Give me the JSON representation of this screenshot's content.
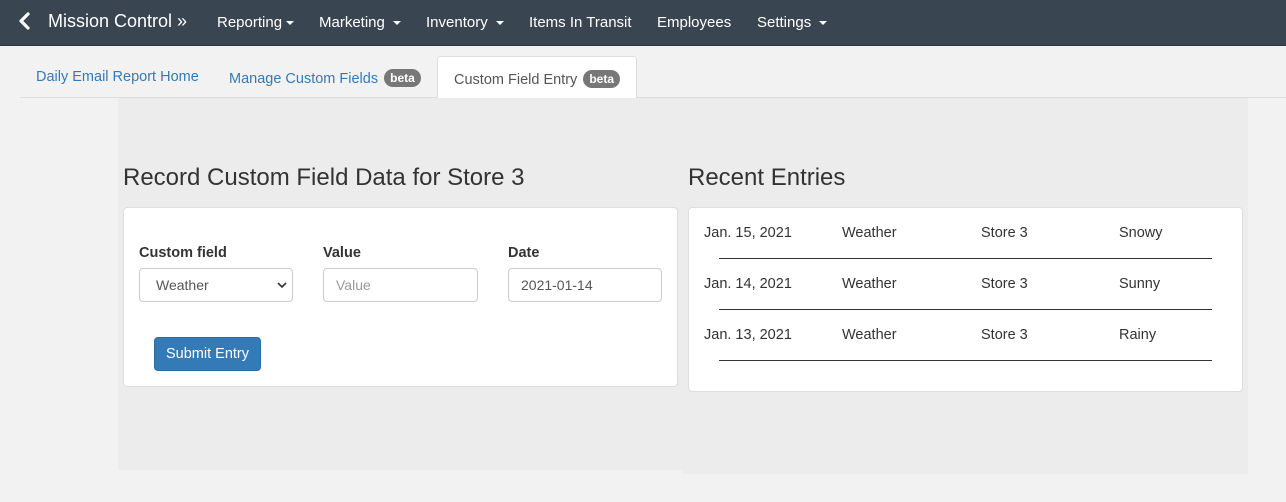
{
  "navbar": {
    "brand": "Mission Control »",
    "items": [
      {
        "label": "Reporting",
        "dropdown": true
      },
      {
        "label": "Marketing",
        "dropdown": true
      },
      {
        "label": "Inventory",
        "dropdown": true
      },
      {
        "label": "Items In Transit",
        "dropdown": false
      },
      {
        "label": "Employees",
        "dropdown": false
      },
      {
        "label": "Settings",
        "dropdown": true
      }
    ]
  },
  "tabs": [
    {
      "label": "Daily Email Report Home",
      "badge": "",
      "active": false
    },
    {
      "label": "Manage Custom Fields",
      "badge": "beta",
      "active": false
    },
    {
      "label": "Custom Field Entry",
      "badge": "beta",
      "active": true
    }
  ],
  "form": {
    "title": "Record Custom Field Data for Store 3",
    "custom_field_label": "Custom field",
    "custom_field_value": "Weather",
    "value_label": "Value",
    "value_placeholder": "Value",
    "date_label": "Date",
    "date_value": "2021-01-14",
    "submit_label": "Submit Entry"
  },
  "recent": {
    "title": "Recent Entries",
    "entries": [
      {
        "date": "Jan. 15, 2021",
        "field": "Weather",
        "store": "Store 3",
        "value": "Snowy"
      },
      {
        "date": "Jan. 14, 2021",
        "field": "Weather",
        "store": "Store 3",
        "value": "Sunny"
      },
      {
        "date": "Jan. 13, 2021",
        "field": "Weather",
        "store": "Store 3",
        "value": "Rainy"
      }
    ]
  },
  "colors": {
    "navbar_bg": "#3a4552",
    "link": "#337ab7",
    "badge": "#777777",
    "primary_button": "#337ab7"
  }
}
